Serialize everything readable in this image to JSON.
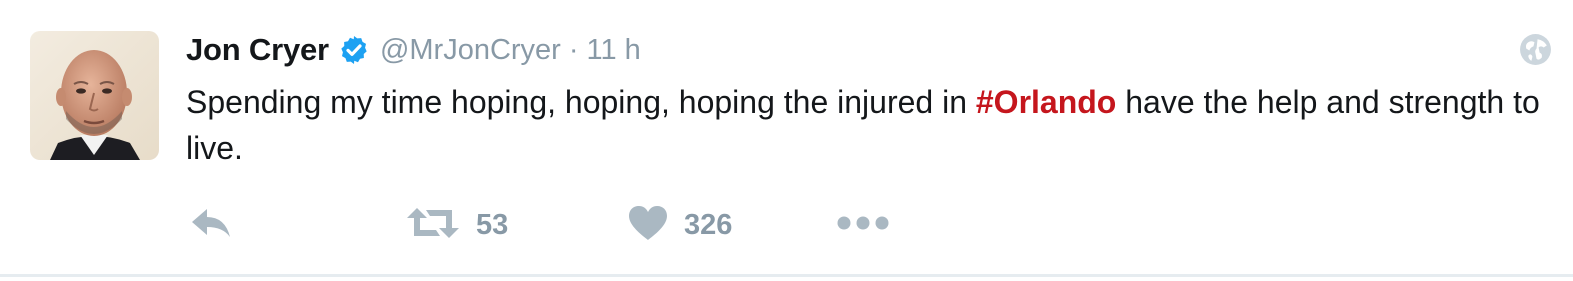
{
  "tweet": {
    "author_name": "Jon Cryer",
    "handle": "@MrJonCryer",
    "separator": "·",
    "time": "11 h",
    "text_before": "Spending my time hoping, hoping, hoping the injured in ",
    "hashtag": "#Orlando",
    "text_after": " have the help and strength to live.",
    "hashtag_color": "#c5161d",
    "verified_color": "#1da1f2"
  },
  "actions": {
    "retweet_count": "53",
    "like_count": "326"
  },
  "icons": [
    "avatar",
    "verified-badge-icon",
    "globe-icon",
    "reply-icon",
    "retweet-icon",
    "heart-icon",
    "more-icon"
  ]
}
